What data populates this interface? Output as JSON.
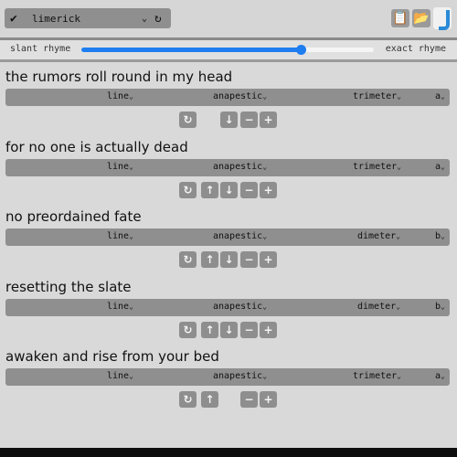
{
  "toolbar": {
    "check_icon": "check-icon",
    "form_label": "limerick",
    "chevron_icon": "chevron-down-icon",
    "refresh_icon": "refresh-icon"
  },
  "slider": {
    "left_label": "slant rhyme",
    "right_label": "exact rhyme",
    "value": 0.75,
    "accent": "#1e7ef0"
  },
  "stanzas": [
    {
      "text": "the rumors roll round in my head",
      "type": "line",
      "foot": "anapestic",
      "meter": "trimeter",
      "rhyme": "a",
      "has_up": false,
      "has_down": true
    },
    {
      "text": "for no one is actually dead",
      "type": "line",
      "foot": "anapestic",
      "meter": "trimeter",
      "rhyme": "a",
      "has_up": true,
      "has_down": true
    },
    {
      "text": "no preordained fate",
      "type": "line",
      "foot": "anapestic",
      "meter": "dimeter",
      "rhyme": "b",
      "has_up": true,
      "has_down": true
    },
    {
      "text": "resetting the slate",
      "type": "line",
      "foot": "anapestic",
      "meter": "dimeter",
      "rhyme": "b",
      "has_up": true,
      "has_down": true
    },
    {
      "text": "awaken and rise from your bed",
      "type": "line",
      "foot": "anapestic",
      "meter": "trimeter",
      "rhyme": "a",
      "has_up": true,
      "has_down": false
    }
  ],
  "glyphs": {
    "caret": "⌄",
    "refresh": "↻",
    "up": "↑",
    "down": "↓",
    "minus": "−",
    "plus": "+"
  }
}
